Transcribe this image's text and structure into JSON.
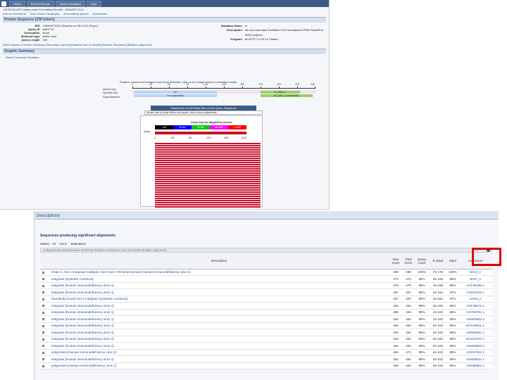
{
  "top": {
    "nav": [
      "Home",
      "Recent Results",
      "Saved Strategies",
      "Help"
    ],
    "breadcrumb": "»NCBI/ BLAST/ blastp suite/ Formatting Results - #NDWE7C014",
    "toolbar": [
      "Edit and Resubmit",
      "Save Search Strategies",
      "▸Formatting options",
      "▸Download"
    ],
    "section_title": "Protein Sequence (239 letters)",
    "meta_left": [
      {
        "k": "RID",
        "v": "YNDEW7C014 (Expires on 08-14 01:03 pm)"
      },
      {
        "k": "Query ID",
        "v": "lcl|64710"
      },
      {
        "k": "Description",
        "v": "None"
      },
      {
        "k": "Molecule type",
        "v": "amino acid"
      },
      {
        "k": "Query Length",
        "v": "239"
      }
    ],
    "meta_right": [
      {
        "k": "Database Name",
        "v": "nr"
      },
      {
        "k": "Description",
        "v": "All non-redundant GenBank CDS translations+PDB+SwissProt"
      },
      {
        "k": "",
        "v": "WGS projects"
      },
      {
        "k": "Program",
        "v": "BLASTP 2.2.29+ ▸ Citation"
      }
    ],
    "other_reports": "Other reports: ▸ Search Summary [Taxonomy reports] [Distance tree of results] [Related Structures] [Multiple alignment]",
    "graphic_summary": "Graphic Summary",
    "show_cd": "Show Conserved Domains",
    "domain_note": "Putative conserved domains have been detected, click on the image below for detailed results.",
    "domain_rows": [
      "Query seq.",
      "Specific hits",
      "Superfamilies"
    ],
    "ruler_ticks": [
      "1",
      "25",
      "50",
      "75",
      "100",
      "125",
      "150",
      "175",
      "200",
      "225",
      "239"
    ],
    "domain_bars": [
      "rve",
      "rve superfamily",
      "IN_DBD_C",
      "IN_DBD_C superfamily"
    ],
    "dist_title": "Distribution of 100 Blast Hits on the Query Sequence",
    "dist_hint": "Mouse over to show define and scores, click to show alignments",
    "color_key_title": "Color key for alignment scores",
    "color_key": [
      {
        "label": "<40",
        "color": "#000000"
      },
      {
        "label": "40-50",
        "color": "#0000ff"
      },
      {
        "label": "50-80",
        "color": "#00cc00"
      },
      {
        "label": "80-200",
        "color": "#ff00ff"
      },
      {
        "label": ">=200",
        "color": "#ff0000"
      }
    ],
    "query_label": "Query",
    "query_ticks": [
      "1",
      "40",
      "80",
      "120",
      "160",
      "200"
    ],
    "hit_color": "#c8102e"
  },
  "bottom": {
    "section": "Descriptions",
    "heading": "Sequences producing significant alignments:",
    "select_label": "Select:",
    "select_all": "All",
    "select_none": "None",
    "selected": "Selected:0",
    "align_bar": "▸Alignments  ▸Download  ▸  GenPept  Graphics  Distance tree of results  Multiple alignment",
    "columns": [
      "Description",
      "Max score",
      "Total score",
      "Query cover",
      "E value",
      "Ident",
      "Accession"
    ],
    "rows": [
      [
        "Chain A, Hiv-1 Integrase Catalytic Core And C-Terminal Domain [Human immunodeficiency virus 1]",
        "490",
        "490",
        "100%",
        "7e-176",
        "100%",
        "1EX4_A"
      ],
      [
        "integrase [synthetic construct]",
        "472",
        "472",
        "98%",
        "6e-169",
        "99%",
        "1K6Y_A"
      ],
      [
        "integrase [Human immunodeficiency virus 1]",
        "470",
        "470",
        "99%",
        "4e-168",
        "96%",
        "ACF35406.1"
      ],
      [
        "integrase [Human immunodeficiency virus 1]",
        "467",
        "467",
        "99%",
        "5e-164",
        "97%",
        "AAS57619.1"
      ],
      [
        "Nanobody-bound HIV-1 integrase [synthetic construct]",
        "467",
        "467",
        "99%",
        "4e-164",
        "97%",
        "4AH9_A"
      ],
      [
        "integrase [Human immunodeficiency virus 1]",
        "464",
        "464",
        "99%",
        "3e-163",
        "96%",
        "AGF45071.1"
      ],
      [
        "integrase [Human immunodeficiency virus 1]",
        "465",
        "465",
        "99%",
        "4e-163",
        "96%",
        "AGO08791.1"
      ],
      [
        "integrase [Human immunodeficiency virus 1]",
        "464",
        "464",
        "99%",
        "4e-163",
        "96%",
        "AGM46822.1"
      ],
      [
        "integrase [Human immunodeficiency virus 1]",
        "464",
        "464",
        "99%",
        "6e-163",
        "96%",
        "BAG18811.1"
      ],
      [
        "integrase [Human immunodeficiency virus 1]",
        "464",
        "464",
        "99%",
        "6e-163",
        "96%",
        "AGM46812.1"
      ],
      [
        "integrase [Human immunodeficiency virus 1]",
        "464",
        "464",
        "99%",
        "6e-163",
        "96%",
        "BAG18797.1"
      ],
      [
        "integrase [Human immunodeficiency virus 1]",
        "464",
        "464",
        "99%",
        "6e-163",
        "96%",
        "AGM46823.1"
      ],
      [
        "polyprotein [Human immunodeficiency virus 1]",
        "464",
        "474",
        "99%",
        "6e-163",
        "96%",
        "AGS57051.1"
      ],
      [
        "integrase [Human immunodeficiency virus 1]",
        "464",
        "464",
        "99%",
        "6e-163",
        "96%",
        "AGM46611.1"
      ],
      [
        "polyprotein [Human immunodeficiency virus 1]",
        "463",
        "463",
        "99%",
        "9e-163",
        "96%",
        "AGS68881.1"
      ]
    ]
  }
}
